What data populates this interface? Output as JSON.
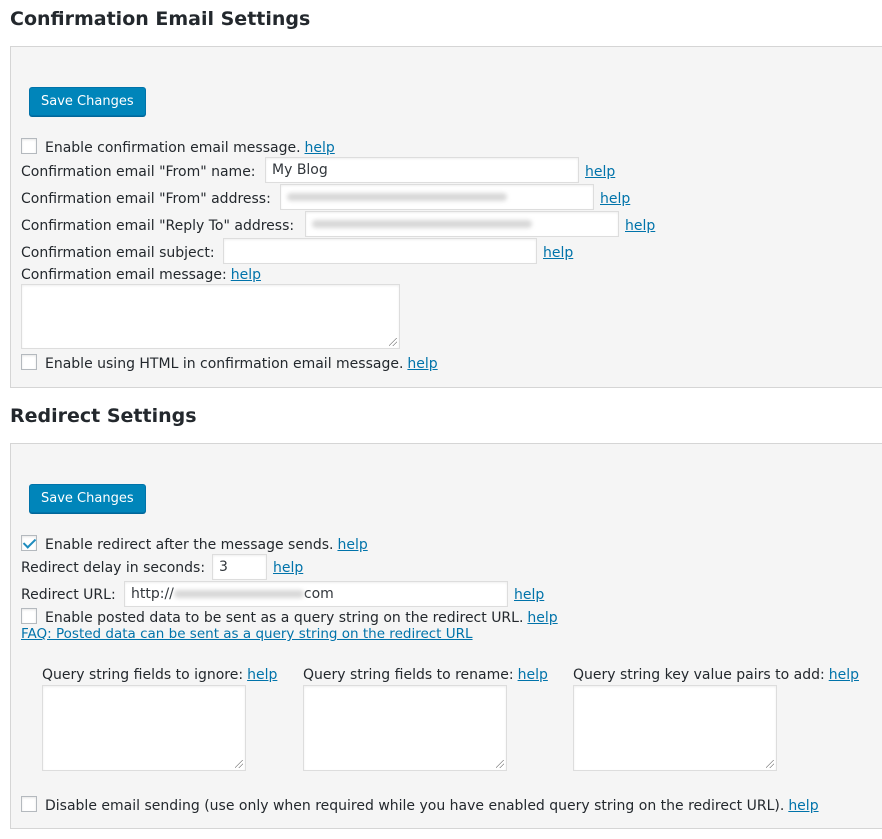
{
  "confirmation": {
    "title": "Confirmation Email Settings",
    "save_label": "Save Changes",
    "enable_label": "Enable confirmation email message.",
    "from_name_label": "Confirmation email \"From\" name:",
    "from_name_value": "My Blog",
    "from_address_label": "Confirmation email \"From\" address:",
    "reply_to_label": "Confirmation email \"Reply To\" address:",
    "subject_label": "Confirmation email subject:",
    "subject_value": "",
    "message_label": "Confirmation email message:",
    "html_label": "Enable using HTML in confirmation email message."
  },
  "redirect": {
    "title": "Redirect Settings",
    "save_label": "Save Changes",
    "enable_label": "Enable redirect after the message sends.",
    "enable_checked": true,
    "delay_label": "Redirect delay in seconds:",
    "delay_value": "3",
    "url_label": "Redirect URL:",
    "url_prefix": "http://",
    "url_suffix": "com",
    "posted_label": "Enable posted data to be sent as a query string on the redirect URL.",
    "faq_link": "FAQ: Posted data can be sent as a query string on the redirect URL",
    "ignore_label": "Query string fields to ignore:",
    "rename_label": "Query string fields to rename:",
    "add_label": "Query string key value pairs to add:",
    "disable_label": "Disable email sending (use only when required while you have enabled query string on the redirect URL)."
  },
  "help_label": "help",
  "colors": {
    "accent": "#0085ba",
    "link": "#0073aa",
    "panel": "#f5f5f5"
  },
  "icons": {
    "checkbox": "checkbox-icon",
    "checkmark": "checkmark-icon",
    "resize": "resize-grip-icon"
  }
}
